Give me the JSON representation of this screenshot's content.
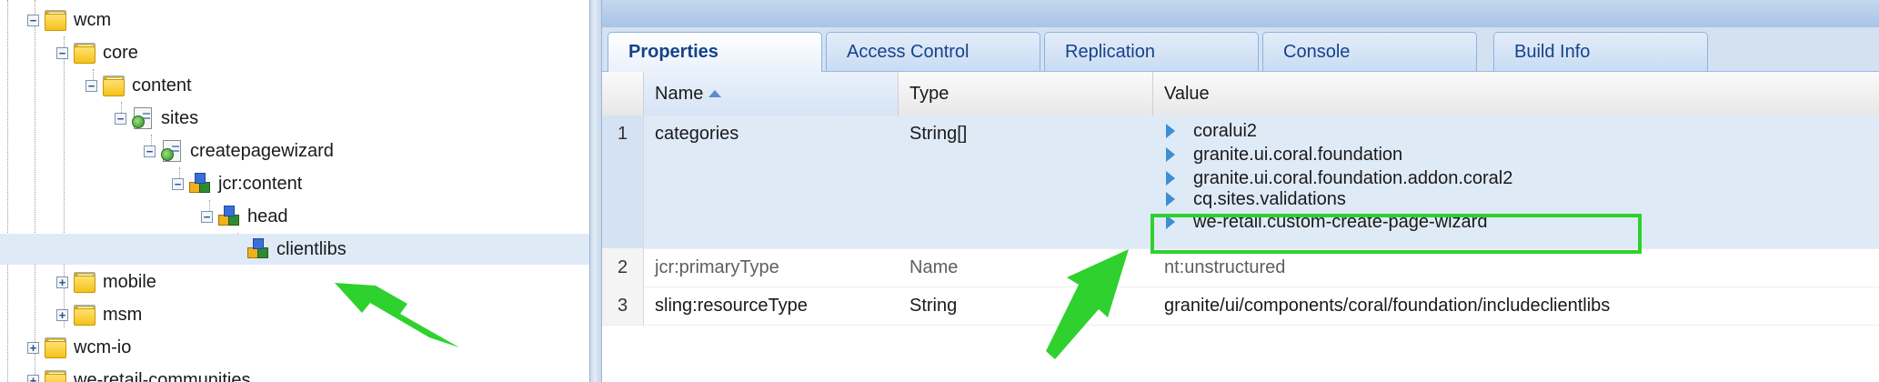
{
  "tree": {
    "nodes": [
      {
        "label": "wcm",
        "icon": "folder-icon",
        "state": "expanded"
      },
      {
        "label": "core",
        "icon": "folder-icon",
        "state": "expanded"
      },
      {
        "label": "content",
        "icon": "folder-icon",
        "state": "expanded"
      },
      {
        "label": "sites",
        "icon": "page-icon",
        "state": "expanded"
      },
      {
        "label": "createpagewizard",
        "icon": "page-icon",
        "state": "expanded"
      },
      {
        "label": "jcr:content",
        "icon": "node-icon",
        "state": "expanded"
      },
      {
        "label": "head",
        "icon": "node-icon",
        "state": "expanded"
      },
      {
        "label": "clientlibs",
        "icon": "node-icon",
        "state": "leaf",
        "selected": true
      },
      {
        "label": "mobile",
        "icon": "folder-icon",
        "state": "collapsed"
      },
      {
        "label": "msm",
        "icon": "folder-icon",
        "state": "collapsed"
      },
      {
        "label": "wcm-io",
        "icon": "folder-icon",
        "state": "collapsed"
      },
      {
        "label": "we-retail-communities",
        "icon": "folder-icon",
        "state": "collapsed"
      }
    ]
  },
  "tabs": [
    {
      "label": "Properties",
      "active": true
    },
    {
      "label": "Access Control"
    },
    {
      "label": "Replication"
    },
    {
      "label": "Console"
    },
    {
      "label": "Build Info"
    }
  ],
  "grid": {
    "columns": {
      "name": "Name",
      "type": "Type",
      "value": "Value"
    },
    "rows": [
      {
        "num": "1",
        "name": "categories",
        "type": "String[]",
        "values": [
          "coralui2",
          "granite.ui.coral.foundation",
          "granite.ui.coral.foundation.addon.coral2",
          "cq.sites.validations",
          "we-retail.custom-create-page-wizard"
        ]
      },
      {
        "num": "2",
        "name": "jcr:primaryType",
        "type": "Name",
        "value": "nt:unstructured"
      },
      {
        "num": "3",
        "name": "sling:resourceType",
        "type": "String",
        "value": "granite/ui/components/coral/foundation/includeclientlibs"
      }
    ]
  },
  "colors": {
    "highlight": "#2ed12e",
    "arrow": "#2ed12e",
    "tab_text": "#15428b",
    "selection": "#dfeaf7"
  }
}
